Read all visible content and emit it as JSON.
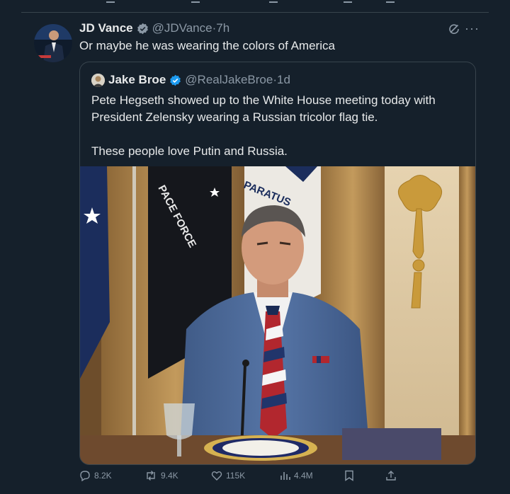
{
  "tweet": {
    "author_name": "JD Vance",
    "author_handle": "@JDVance",
    "separator": "·",
    "time": "7h",
    "text": "Or maybe he was wearing the colors of America"
  },
  "quote": {
    "author_name": "Jake Broe",
    "author_handle": "@RealJakeBroe",
    "separator": "·",
    "time": "1d",
    "paragraphs": [
      "Pete Hegseth showed up to the White House meeting today with President Zelensky wearing a Russian tricolor flag tie.",
      "These people love Putin and Russia."
    ],
    "photo": {
      "flag_text_left": "PACE FORCE",
      "flag_text_right": "PARATUS"
    }
  },
  "actions": {
    "replies": "8.2K",
    "reposts": "9.4K",
    "likes": "115K",
    "views": "4.4M"
  },
  "icons": [
    "verified-badge-icon",
    "grok-icon",
    "more-icon",
    "reply-icon",
    "repost-icon",
    "like-icon",
    "views-icon",
    "bookmark-icon",
    "share-icon"
  ],
  "colors": {
    "background": "#15202b",
    "text": "#e7e9ea",
    "muted": "#8b98a5",
    "verified_gold": "#8b98a5",
    "verified_blue": "#1d9bf0",
    "border": "#38444d"
  }
}
